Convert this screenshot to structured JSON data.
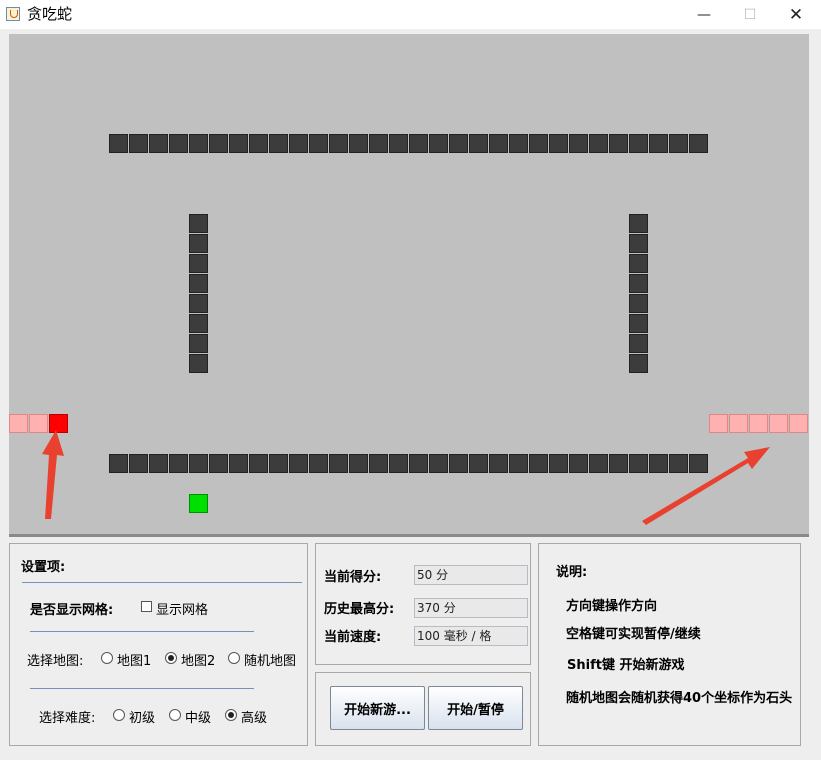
{
  "window": {
    "title": "贪吃蛇",
    "minimize_glyph": "—",
    "maximize_glyph": "☐",
    "close_glyph": "✕"
  },
  "colors": {
    "board_bg": "#c0c0c0",
    "wall": "#3c3c3c",
    "snake_head": "#ff0000",
    "snake_body": "#ffb0b0",
    "food": "#00e000",
    "annotation_arrow": "#e8412f"
  },
  "settings": {
    "heading": "设置项:",
    "grid_label": "是否显示网格:",
    "grid_checkbox_label": "显示网格",
    "grid_checked": false,
    "map_label": "选择地图:",
    "map_options": [
      "地图1",
      "地图2",
      "随机地图"
    ],
    "map_selected": "地图2",
    "difficulty_label": "选择难度:",
    "difficulty_options": [
      "初级",
      "中级",
      "高级"
    ],
    "difficulty_selected": "高级"
  },
  "score": {
    "current_label": "当前得分:",
    "current_value": "50 分",
    "best_label": "历史最高分:",
    "best_value": "370 分",
    "speed_label": "当前速度:",
    "speed_value": "100 毫秒 / 格"
  },
  "buttons": {
    "new_game": "开始新游...",
    "pause": "开始/暂停"
  },
  "help": {
    "heading": "说明:",
    "lines": [
      "方向键操作方向",
      "空格键可实现暂停/继续",
      "Shift键 开始新游戏",
      "随机地图会随机获得40个坐标作为石头"
    ]
  }
}
